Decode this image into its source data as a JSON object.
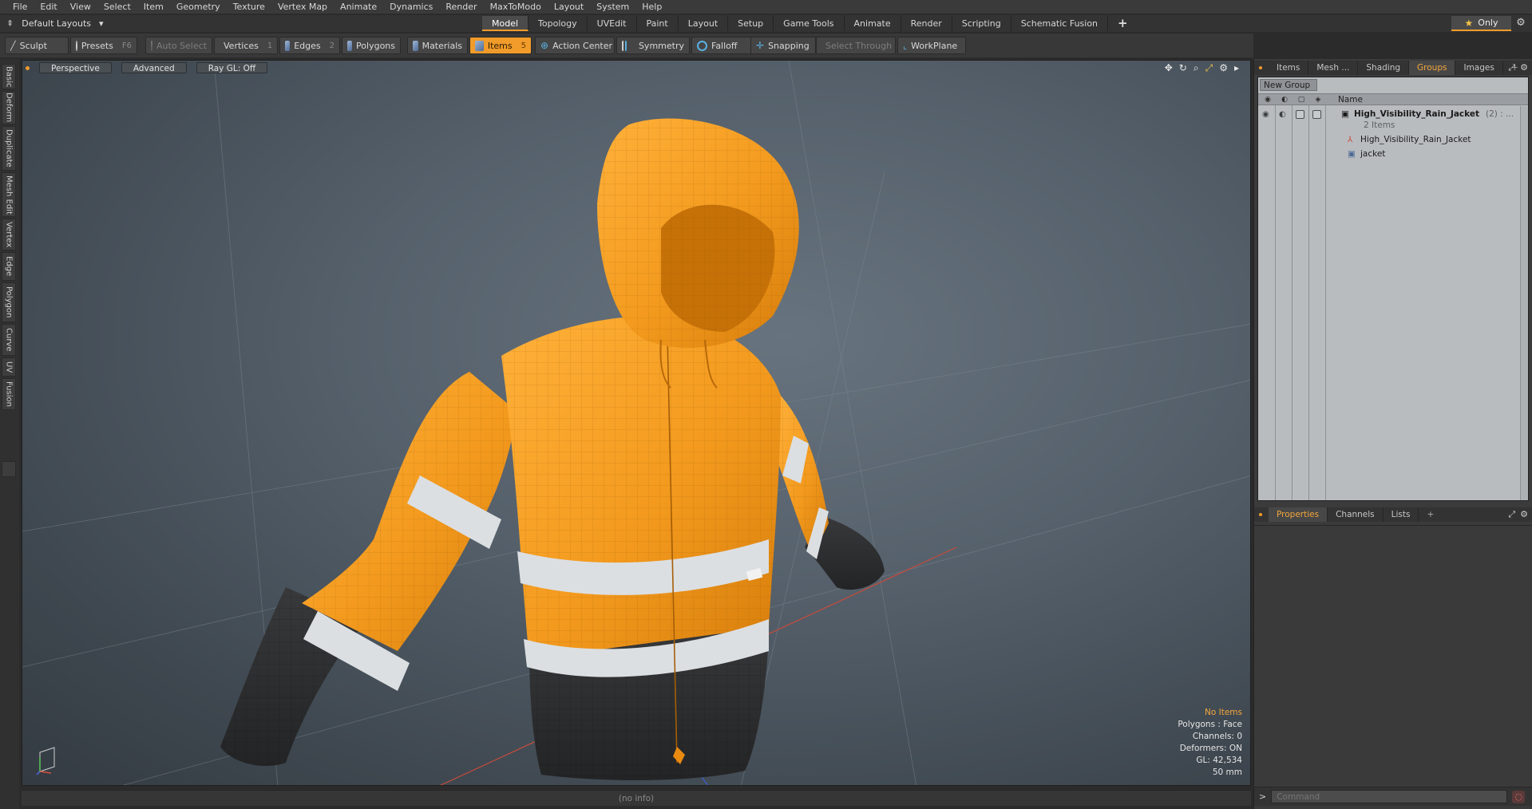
{
  "menu": [
    "File",
    "Edit",
    "View",
    "Select",
    "Item",
    "Geometry",
    "Texture",
    "Vertex Map",
    "Animate",
    "Dynamics",
    "Render",
    "MaxToModo",
    "Layout",
    "System",
    "Help"
  ],
  "layout": {
    "name": "Default Layouts"
  },
  "tabs": [
    "Model",
    "Topology",
    "UVEdit",
    "Paint",
    "Layout",
    "Setup",
    "Game Tools",
    "Animate",
    "Render",
    "Scripting",
    "Schematic Fusion"
  ],
  "active_tab": "Model",
  "only_label": "Only",
  "toolbar": {
    "sculpt": "Sculpt",
    "presets": "Presets",
    "presets_key": "F6",
    "auto_select": "Auto Select",
    "vertices": "Vertices",
    "vertices_key": "1",
    "edges": "Edges",
    "edges_key": "2",
    "polygons": "Polygons",
    "materials": "Materials",
    "items": "Items",
    "items_key": "5",
    "action_center": "Action Center",
    "symmetry": "Symmetry",
    "falloff": "Falloff",
    "snapping": "Snapping",
    "select_through": "Select Through",
    "workplane": "WorkPlane"
  },
  "left_tabs": [
    "Basic",
    "Deform",
    "Duplicate",
    "Mesh Edit",
    "Vertex",
    "Edge",
    "Polygon",
    "Curve",
    "UV",
    "Fusion"
  ],
  "viewport": {
    "view": "Perspective",
    "shading": "Advanced",
    "raygl": "Ray GL: Off",
    "info": {
      "items": "No Items",
      "polygons": "Polygons : Face",
      "channels": "Channels: 0",
      "deformers": "Deformers: ON",
      "gl": "GL: 42,534",
      "scale": "50 mm"
    }
  },
  "status": "(no info)",
  "right_panel": {
    "top_tabs": [
      "Items",
      "Mesh ...",
      "Shading",
      "Groups",
      "Images"
    ],
    "active_top_tab": "Groups",
    "new_group": "New Group",
    "column_name": "Name",
    "group": {
      "name": "High_Visibility_Rain_Jacket",
      "count": "(2) : ...",
      "subtitle": "2 Items",
      "children": [
        "High_Visibility_Rain_Jacket",
        "jacket"
      ]
    },
    "bottom_tabs": [
      "Properties",
      "Channels",
      "Lists"
    ],
    "active_bottom_tab": "Properties",
    "command_placeholder": "Command"
  },
  "colors": {
    "accent": "#f09b2a",
    "jacket_orange": "#f39a1e",
    "reflective": "#d9dcdf",
    "dark_fabric": "#2f3032"
  },
  "icons": [
    "layout-icon",
    "sculpt-icon",
    "presets-icon",
    "cube-icon",
    "star-icon",
    "gear-icon",
    "move-icon",
    "rotate-icon",
    "zoom-icon",
    "maximize-icon",
    "eye-icon",
    "lock-icon",
    "stop-icon"
  ]
}
